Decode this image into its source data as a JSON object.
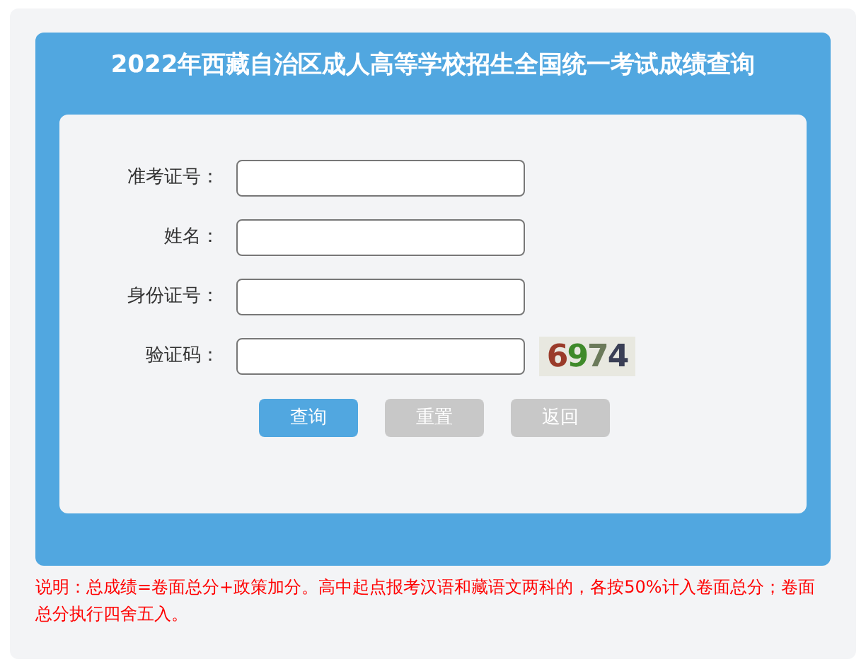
{
  "title": "2022年西藏自治区成人高等学校招生全国统一考试成绩查询",
  "fields": [
    {
      "label": "准考证号："
    },
    {
      "label": "姓名："
    },
    {
      "label": "身份证号："
    },
    {
      "label": "验证码：",
      "captcha": "6974"
    }
  ],
  "buttons": [
    {
      "label": "查询",
      "primary": true
    },
    {
      "label": "重置",
      "primary": false
    },
    {
      "label": "返回",
      "primary": false
    }
  ],
  "note": "说明：总成绩=卷面总分+政策加分。高中起点报考汉语和藏语文两科的，各按50%计入卷面总分；卷面总分执行四舍五入。"
}
